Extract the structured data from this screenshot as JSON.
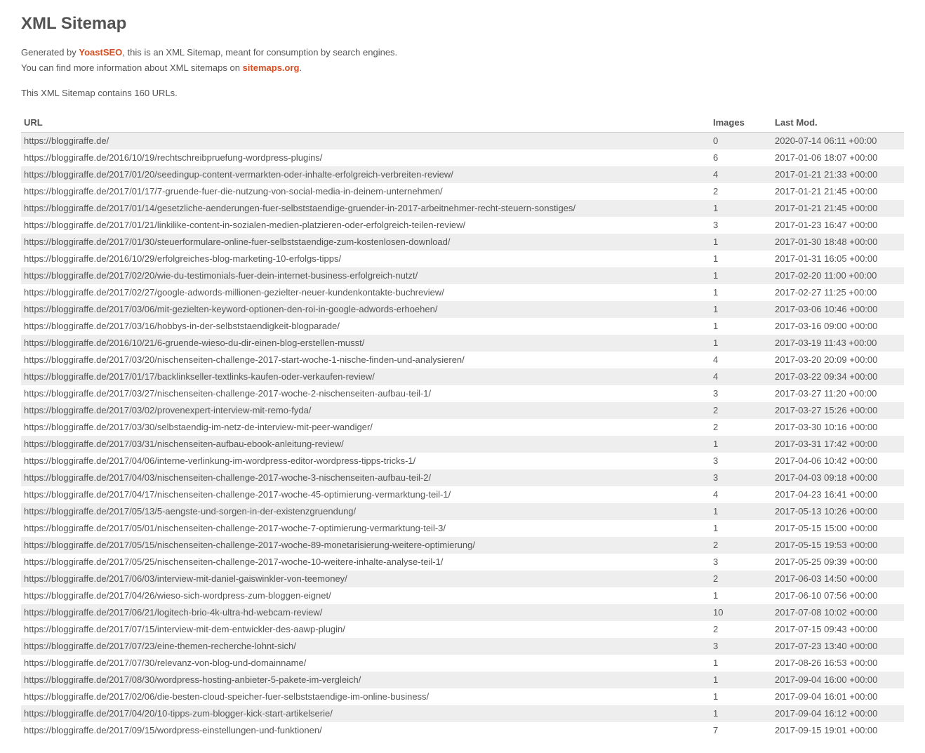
{
  "heading": "XML Sitemap",
  "intro": {
    "prefix": "Generated by ",
    "plugin": "YoastSEO",
    "line1": ", this is an XML Sitemap, meant for consumption by search engines.",
    "line2a": "You can find more information about XML sitemaps on ",
    "linktext": "sitemaps.org",
    "line2b": "."
  },
  "count_line": "This XML Sitemap contains 160 URLs.",
  "columns": {
    "url": "URL",
    "images": "Images",
    "lastmod": "Last Mod."
  },
  "rows": [
    {
      "url": "https://bloggiraffe.de/",
      "images": "0",
      "lastmod": "2020-07-14 06:11 +00:00"
    },
    {
      "url": "https://bloggiraffe.de/2016/10/19/rechtschreibpruefung-wordpress-plugins/",
      "images": "6",
      "lastmod": "2017-01-06 18:07 +00:00"
    },
    {
      "url": "https://bloggiraffe.de/2017/01/20/seedingup-content-vermarkten-oder-inhalte-erfolgreich-verbreiten-review/",
      "images": "4",
      "lastmod": "2017-01-21 21:33 +00:00"
    },
    {
      "url": "https://bloggiraffe.de/2017/01/17/7-gruende-fuer-die-nutzung-von-social-media-in-deinem-unternehmen/",
      "images": "2",
      "lastmod": "2017-01-21 21:45 +00:00"
    },
    {
      "url": "https://bloggiraffe.de/2017/01/14/gesetzliche-aenderungen-fuer-selbststaendige-gruender-in-2017-arbeitnehmer-recht-steuern-sonstiges/",
      "images": "1",
      "lastmod": "2017-01-21 21:45 +00:00"
    },
    {
      "url": "https://bloggiraffe.de/2017/01/21/linkilike-content-in-sozialen-medien-platzieren-oder-erfolgreich-teilen-review/",
      "images": "3",
      "lastmod": "2017-01-23 16:47 +00:00"
    },
    {
      "url": "https://bloggiraffe.de/2017/01/30/steuerformulare-online-fuer-selbststaendige-zum-kostenlosen-download/",
      "images": "1",
      "lastmod": "2017-01-30 18:48 +00:00"
    },
    {
      "url": "https://bloggiraffe.de/2016/10/29/erfolgreiches-blog-marketing-10-erfolgs-tipps/",
      "images": "1",
      "lastmod": "2017-01-31 16:05 +00:00"
    },
    {
      "url": "https://bloggiraffe.de/2017/02/20/wie-du-testimonials-fuer-dein-internet-business-erfolgreich-nutzt/",
      "images": "1",
      "lastmod": "2017-02-20 11:00 +00:00"
    },
    {
      "url": "https://bloggiraffe.de/2017/02/27/google-adwords-millionen-gezielter-neuer-kundenkontakte-buchreview/",
      "images": "1",
      "lastmod": "2017-02-27 11:25 +00:00"
    },
    {
      "url": "https://bloggiraffe.de/2017/03/06/mit-gezielten-keyword-optionen-den-roi-in-google-adwords-erhoehen/",
      "images": "1",
      "lastmod": "2017-03-06 10:46 +00:00"
    },
    {
      "url": "https://bloggiraffe.de/2017/03/16/hobbys-in-der-selbststaendigkeit-blogparade/",
      "images": "1",
      "lastmod": "2017-03-16 09:00 +00:00"
    },
    {
      "url": "https://bloggiraffe.de/2016/10/21/6-gruende-wieso-du-dir-einen-blog-erstellen-musst/",
      "images": "1",
      "lastmod": "2017-03-19 11:43 +00:00"
    },
    {
      "url": "https://bloggiraffe.de/2017/03/20/nischenseiten-challenge-2017-start-woche-1-nische-finden-und-analysieren/",
      "images": "4",
      "lastmod": "2017-03-20 20:09 +00:00"
    },
    {
      "url": "https://bloggiraffe.de/2017/01/17/backlinkseller-textlinks-kaufen-oder-verkaufen-review/",
      "images": "4",
      "lastmod": "2017-03-22 09:34 +00:00"
    },
    {
      "url": "https://bloggiraffe.de/2017/03/27/nischenseiten-challenge-2017-woche-2-nischenseiten-aufbau-teil-1/",
      "images": "3",
      "lastmod": "2017-03-27 11:20 +00:00"
    },
    {
      "url": "https://bloggiraffe.de/2017/03/02/provenexpert-interview-mit-remo-fyda/",
      "images": "2",
      "lastmod": "2017-03-27 15:26 +00:00"
    },
    {
      "url": "https://bloggiraffe.de/2017/03/30/selbstaendig-im-netz-de-interview-mit-peer-wandiger/",
      "images": "2",
      "lastmod": "2017-03-30 10:16 +00:00"
    },
    {
      "url": "https://bloggiraffe.de/2017/03/31/nischenseiten-aufbau-ebook-anleitung-review/",
      "images": "1",
      "lastmod": "2017-03-31 17:42 +00:00"
    },
    {
      "url": "https://bloggiraffe.de/2017/04/06/interne-verlinkung-im-wordpress-editor-wordpress-tipps-tricks-1/",
      "images": "3",
      "lastmod": "2017-04-06 10:42 +00:00"
    },
    {
      "url": "https://bloggiraffe.de/2017/04/03/nischenseiten-challenge-2017-woche-3-nischenseiten-aufbau-teil-2/",
      "images": "3",
      "lastmod": "2017-04-03 09:18 +00:00"
    },
    {
      "url": "https://bloggiraffe.de/2017/04/17/nischenseiten-challenge-2017-woche-45-optimierung-vermarktung-teil-1/",
      "images": "4",
      "lastmod": "2017-04-23 16:41 +00:00"
    },
    {
      "url": "https://bloggiraffe.de/2017/05/13/5-aengste-und-sorgen-in-der-existenzgruendung/",
      "images": "1",
      "lastmod": "2017-05-13 10:26 +00:00"
    },
    {
      "url": "https://bloggiraffe.de/2017/05/01/nischenseiten-challenge-2017-woche-7-optimierung-vermarktung-teil-3/",
      "images": "1",
      "lastmod": "2017-05-15 15:00 +00:00"
    },
    {
      "url": "https://bloggiraffe.de/2017/05/15/nischenseiten-challenge-2017-woche-89-monetarisierung-weitere-optimierung/",
      "images": "2",
      "lastmod": "2017-05-15 19:53 +00:00"
    },
    {
      "url": "https://bloggiraffe.de/2017/05/25/nischenseiten-challenge-2017-woche-10-weitere-inhalte-analyse-teil-1/",
      "images": "3",
      "lastmod": "2017-05-25 09:39 +00:00"
    },
    {
      "url": "https://bloggiraffe.de/2017/06/03/interview-mit-daniel-gaiswinkler-von-teemoney/",
      "images": "2",
      "lastmod": "2017-06-03 14:50 +00:00"
    },
    {
      "url": "https://bloggiraffe.de/2017/04/26/wieso-sich-wordpress-zum-bloggen-eignet/",
      "images": "1",
      "lastmod": "2017-06-10 07:56 +00:00"
    },
    {
      "url": "https://bloggiraffe.de/2017/06/21/logitech-brio-4k-ultra-hd-webcam-review/",
      "images": "10",
      "lastmod": "2017-07-08 10:02 +00:00"
    },
    {
      "url": "https://bloggiraffe.de/2017/07/15/interview-mit-dem-entwickler-des-aawp-plugin/",
      "images": "2",
      "lastmod": "2017-07-15 09:43 +00:00"
    },
    {
      "url": "https://bloggiraffe.de/2017/07/23/eine-themen-recherche-lohnt-sich/",
      "images": "3",
      "lastmod": "2017-07-23 13:40 +00:00"
    },
    {
      "url": "https://bloggiraffe.de/2017/07/30/relevanz-von-blog-und-domainname/",
      "images": "1",
      "lastmod": "2017-08-26 16:53 +00:00"
    },
    {
      "url": "https://bloggiraffe.de/2017/08/30/wordpress-hosting-anbieter-5-pakete-im-vergleich/",
      "images": "1",
      "lastmod": "2017-09-04 16:00 +00:00"
    },
    {
      "url": "https://bloggiraffe.de/2017/02/06/die-besten-cloud-speicher-fuer-selbststaendige-im-online-business/",
      "images": "1",
      "lastmod": "2017-09-04 16:01 +00:00"
    },
    {
      "url": "https://bloggiraffe.de/2017/04/20/10-tipps-zum-blogger-kick-start-artikelserie/",
      "images": "1",
      "lastmod": "2017-09-04 16:12 +00:00"
    },
    {
      "url": "https://bloggiraffe.de/2017/09/15/wordpress-einstellungen-und-funktionen/",
      "images": "7",
      "lastmod": "2017-09-15 19:01 +00:00"
    }
  ]
}
